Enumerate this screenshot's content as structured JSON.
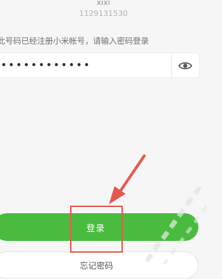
{
  "account": {
    "username": "xixi",
    "user_id": "1129131530"
  },
  "login": {
    "hint_text": "此号码已经注册小米帐号，请输入密码登录",
    "password_value": "••••••••••••",
    "show_password_icon": "eye-icon",
    "submit_label": "登录",
    "forgot_label": "忘记密码"
  },
  "annotation": {
    "highlight_color": "#e5584f",
    "arrow_color": "#e5584f"
  },
  "colors": {
    "primary_green": "#49bc3f",
    "background": "#f6f6f6"
  }
}
